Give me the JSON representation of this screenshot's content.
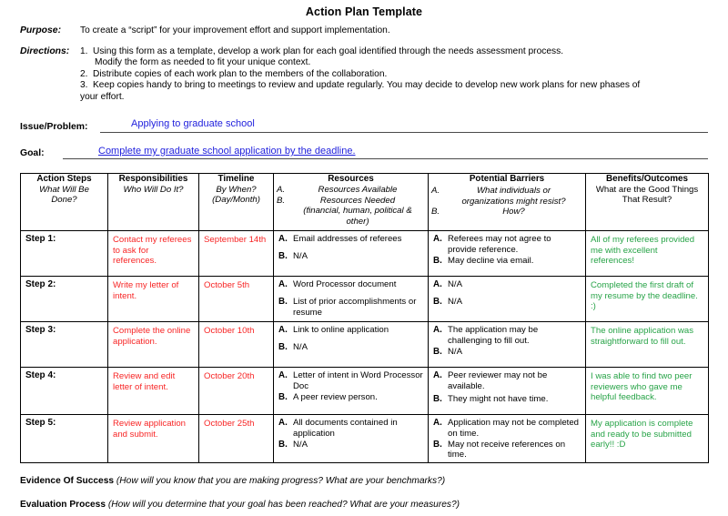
{
  "document": {
    "title": "Action Plan Template"
  },
  "intro": {
    "purpose_label": "Purpose:",
    "purpose_text": "To create a “script” for your improvement effort and support implementation.",
    "directions_label": "Directions:",
    "directions": [
      {
        "num": "1.",
        "text": "Using this form as a template, develop a work plan for each goal identified through the needs assessment process.",
        "sub": "Modify the form as needed to fit your unique context."
      },
      {
        "num": "2.",
        "text": "Distribute copies of each work plan to the members of the collaboration.",
        "sub": ""
      },
      {
        "num": "3.",
        "text": "Keep copies handy to bring to meetings to review and update regularly.  You may decide to develop new work plans for new phases of",
        "sub": "your effort."
      }
    ]
  },
  "fields": {
    "issue_label": "Issue/Problem:",
    "issue_value": "Applying to graduate school",
    "goal_label": "Goal:",
    "goal_value": "Complete my graduate school application by the deadline."
  },
  "table": {
    "headers": {
      "action_steps": {
        "title": "Action Steps",
        "sub1": "What Will Be",
        "sub2": "Done?"
      },
      "responsibilities": {
        "title": "Responsibilities",
        "sub1": "Who Will Do It?"
      },
      "timeline": {
        "title": "Timeline",
        "sub1": "By When?",
        "sub2": "(Day/Month)"
      },
      "resources": {
        "title": "Resources",
        "a_key": "A.",
        "a_text": "Resources Available",
        "b_key": "B.",
        "b_text": "Resources Needed",
        "b_cont1": "(financial, human, political &",
        "b_cont2": "other)"
      },
      "barriers": {
        "title": "Potential Barriers",
        "a_key": "A.",
        "a_text": "What individuals or",
        "a_cont": "organizations might resist?",
        "b_key": "B.",
        "b_text": "How?"
      },
      "benefits": {
        "title": "Benefits/Outcomes",
        "sub1": "What are the Good Things",
        "sub2": "That Result?"
      }
    },
    "key_a": "A.",
    "key_b": "B.",
    "rows": [
      {
        "step": "Step 1:",
        "responsibility": "Contact my referees to ask for references.",
        "timeline": "September 14th",
        "resources_a": "Email addresses of referees",
        "resources_b": "N/A",
        "barriers_a": "Referees may not agree to provide reference.",
        "barriers_b": "May decline via email.",
        "benefits": "All of my referees provided me with excellent references!"
      },
      {
        "step": "Step 2:",
        "responsibility": "Write my letter of intent.",
        "timeline": "October 5th",
        "resources_a": "Word Processor document",
        "resources_b": "List of prior accomplishments or resume",
        "barriers_a": "N/A",
        "barriers_b": "N/A",
        "benefits": "Completed the first draft of my resume by the deadline. :)"
      },
      {
        "step": "Step 3:",
        "responsibility": "Complete the online application.",
        "timeline": "October 10th",
        "resources_a": "Link to online application",
        "resources_b": "N/A",
        "barriers_a": "The application may be challenging to fill out.",
        "barriers_b": "N/A",
        "benefits": "The online application was straightforward to fill out."
      },
      {
        "step": "Step 4:",
        "responsibility": "Review and edit letter of intent.",
        "timeline": "October 20th",
        "resources_a": "Letter of intent in Word Processor Doc",
        "resources_b": "A peer review person.",
        "barriers_a": "Peer reviewer may not be available.",
        "barriers_b": "They might not have time.",
        "benefits": "I was able to find two peer reviewers who gave me helpful feedback."
      },
      {
        "step": "Step 5:",
        "responsibility": "Review application and submit.",
        "timeline": "October 25th",
        "resources_a": "All documents contained in application",
        "resources_b": "N/A",
        "barriers_a": "Application may not be completed on time.",
        "barriers_b": "May not receive references on time.",
        "benefits": "My application is complete and ready to be submitted early!! :D"
      }
    ]
  },
  "footer": {
    "evidence_label": "Evidence Of Success",
    "evidence_question": "(How will you know that you are making progress? What are your benchmarks?)",
    "evaluation_label": "Evaluation Process",
    "evaluation_question": "(How will you determine that your goal has been reached? What are your measures?)"
  },
  "colors": {
    "user_entry_blue": "#2222dd",
    "plan_red": "#f72525",
    "outcome_green": "#27a347",
    "rule_gray": "#4a4a4a"
  }
}
